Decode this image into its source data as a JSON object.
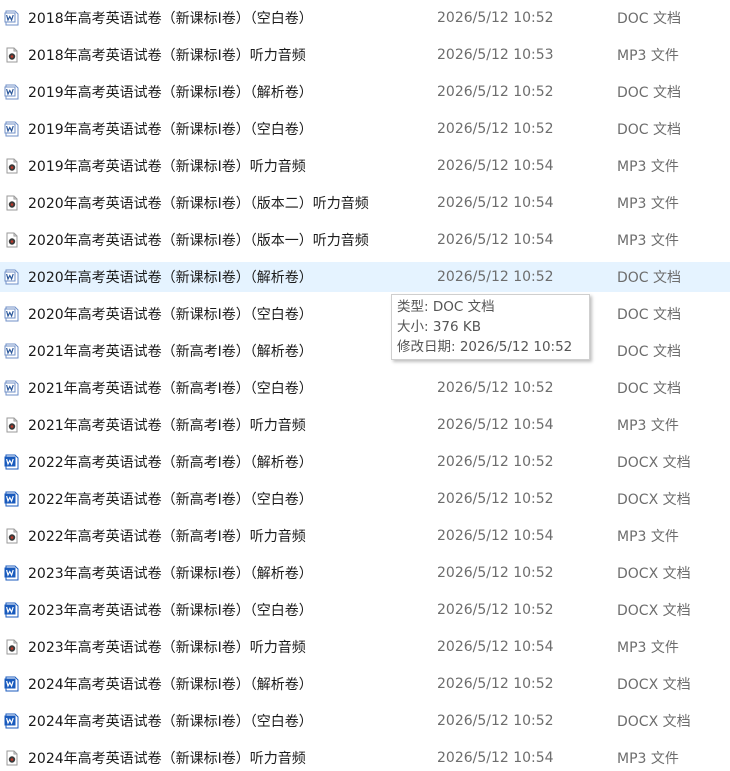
{
  "rows": [
    {
      "name": "2018年高考英语试卷（新课标Ⅰ卷）（空白卷）",
      "date": "2026/5/12 10:52",
      "type": "DOC 文档",
      "icon": "doc-icon"
    },
    {
      "name": "2018年高考英语试卷（新课标Ⅰ卷）听力音频",
      "date": "2026/5/12 10:53",
      "type": "MP3 文件",
      "icon": "mp3-icon"
    },
    {
      "name": "2019年高考英语试卷（新课标Ⅰ卷）（解析卷）",
      "date": "2026/5/12 10:52",
      "type": "DOC 文档",
      "icon": "doc-icon"
    },
    {
      "name": "2019年高考英语试卷（新课标Ⅰ卷）（空白卷）",
      "date": "2026/5/12 10:52",
      "type": "DOC 文档",
      "icon": "doc-icon"
    },
    {
      "name": "2019年高考英语试卷（新课标Ⅰ卷）听力音频",
      "date": "2026/5/12 10:54",
      "type": "MP3 文件",
      "icon": "mp3-icon"
    },
    {
      "name": "2020年高考英语试卷（新课标Ⅰ卷）（版本二）听力音频",
      "date": "2026/5/12 10:54",
      "type": "MP3 文件",
      "icon": "mp3-icon"
    },
    {
      "name": "2020年高考英语试卷（新课标Ⅰ卷）（版本一）听力音频",
      "date": "2026/5/12 10:54",
      "type": "MP3 文件",
      "icon": "mp3-icon"
    },
    {
      "name": "2020年高考英语试卷（新课标Ⅰ卷）（解析卷）",
      "date": "2026/5/12 10:52",
      "type": "DOC 文档",
      "icon": "doc-icon"
    },
    {
      "name": "2020年高考英语试卷（新课标Ⅰ卷）（空白卷）",
      "date": "",
      "type": "DOC 文档",
      "icon": "doc-icon"
    },
    {
      "name": "2021年高考英语试卷（新高考Ⅰ卷）（解析卷）",
      "date": "",
      "type": "DOC 文档",
      "icon": "doc-icon"
    },
    {
      "name": "2021年高考英语试卷（新高考Ⅰ卷）（空白卷）",
      "date": "2026/5/12 10:52",
      "type": "DOC 文档",
      "icon": "doc-icon"
    },
    {
      "name": "2021年高考英语试卷（新高考Ⅰ卷）听力音频",
      "date": "2026/5/12 10:54",
      "type": "MP3 文件",
      "icon": "mp3-icon"
    },
    {
      "name": "2022年高考英语试卷（新高考Ⅰ卷）（解析卷）",
      "date": "2026/5/12 10:52",
      "type": "DOCX 文档",
      "icon": "docx-icon"
    },
    {
      "name": "2022年高考英语试卷（新高考Ⅰ卷）（空白卷）",
      "date": "2026/5/12 10:52",
      "type": "DOCX 文档",
      "icon": "docx-icon"
    },
    {
      "name": "2022年高考英语试卷（新高考Ⅰ卷）听力音频",
      "date": "2026/5/12 10:54",
      "type": "MP3 文件",
      "icon": "mp3-icon"
    },
    {
      "name": "2023年高考英语试卷（新课标Ⅰ卷）（解析卷）",
      "date": "2026/5/12 10:52",
      "type": "DOCX 文档",
      "icon": "docx-icon"
    },
    {
      "name": "2023年高考英语试卷（新课标Ⅰ卷）（空白卷）",
      "date": "2026/5/12 10:52",
      "type": "DOCX 文档",
      "icon": "docx-icon"
    },
    {
      "name": "2023年高考英语试卷（新课标Ⅰ卷）听力音频",
      "date": "2026/5/12 10:54",
      "type": "MP3 文件",
      "icon": "mp3-icon"
    },
    {
      "name": "2024年高考英语试卷（新课标Ⅰ卷）（解析卷）",
      "date": "2026/5/12 10:52",
      "type": "DOCX 文档",
      "icon": "docx-icon"
    },
    {
      "name": "2024年高考英语试卷（新课标Ⅰ卷）（空白卷）",
      "date": "2026/5/12 10:52",
      "type": "DOCX 文档",
      "icon": "docx-icon"
    },
    {
      "name": "2024年高考英语试卷（新课标Ⅰ卷）听力音频",
      "date": "2026/5/12 10:54",
      "type": "MP3 文件",
      "icon": "mp3-icon"
    }
  ],
  "hovered_row": 7,
  "tooltip": {
    "type_line": "类型: DOC 文档",
    "size_line": "大小: 376 KB",
    "date_line": "修改日期: 2026/5/12 10:52"
  },
  "colors": {
    "hover_background": "#e5f3ff",
    "doc_blue": "#2b579a",
    "mp3_red": "#b03a2e"
  }
}
